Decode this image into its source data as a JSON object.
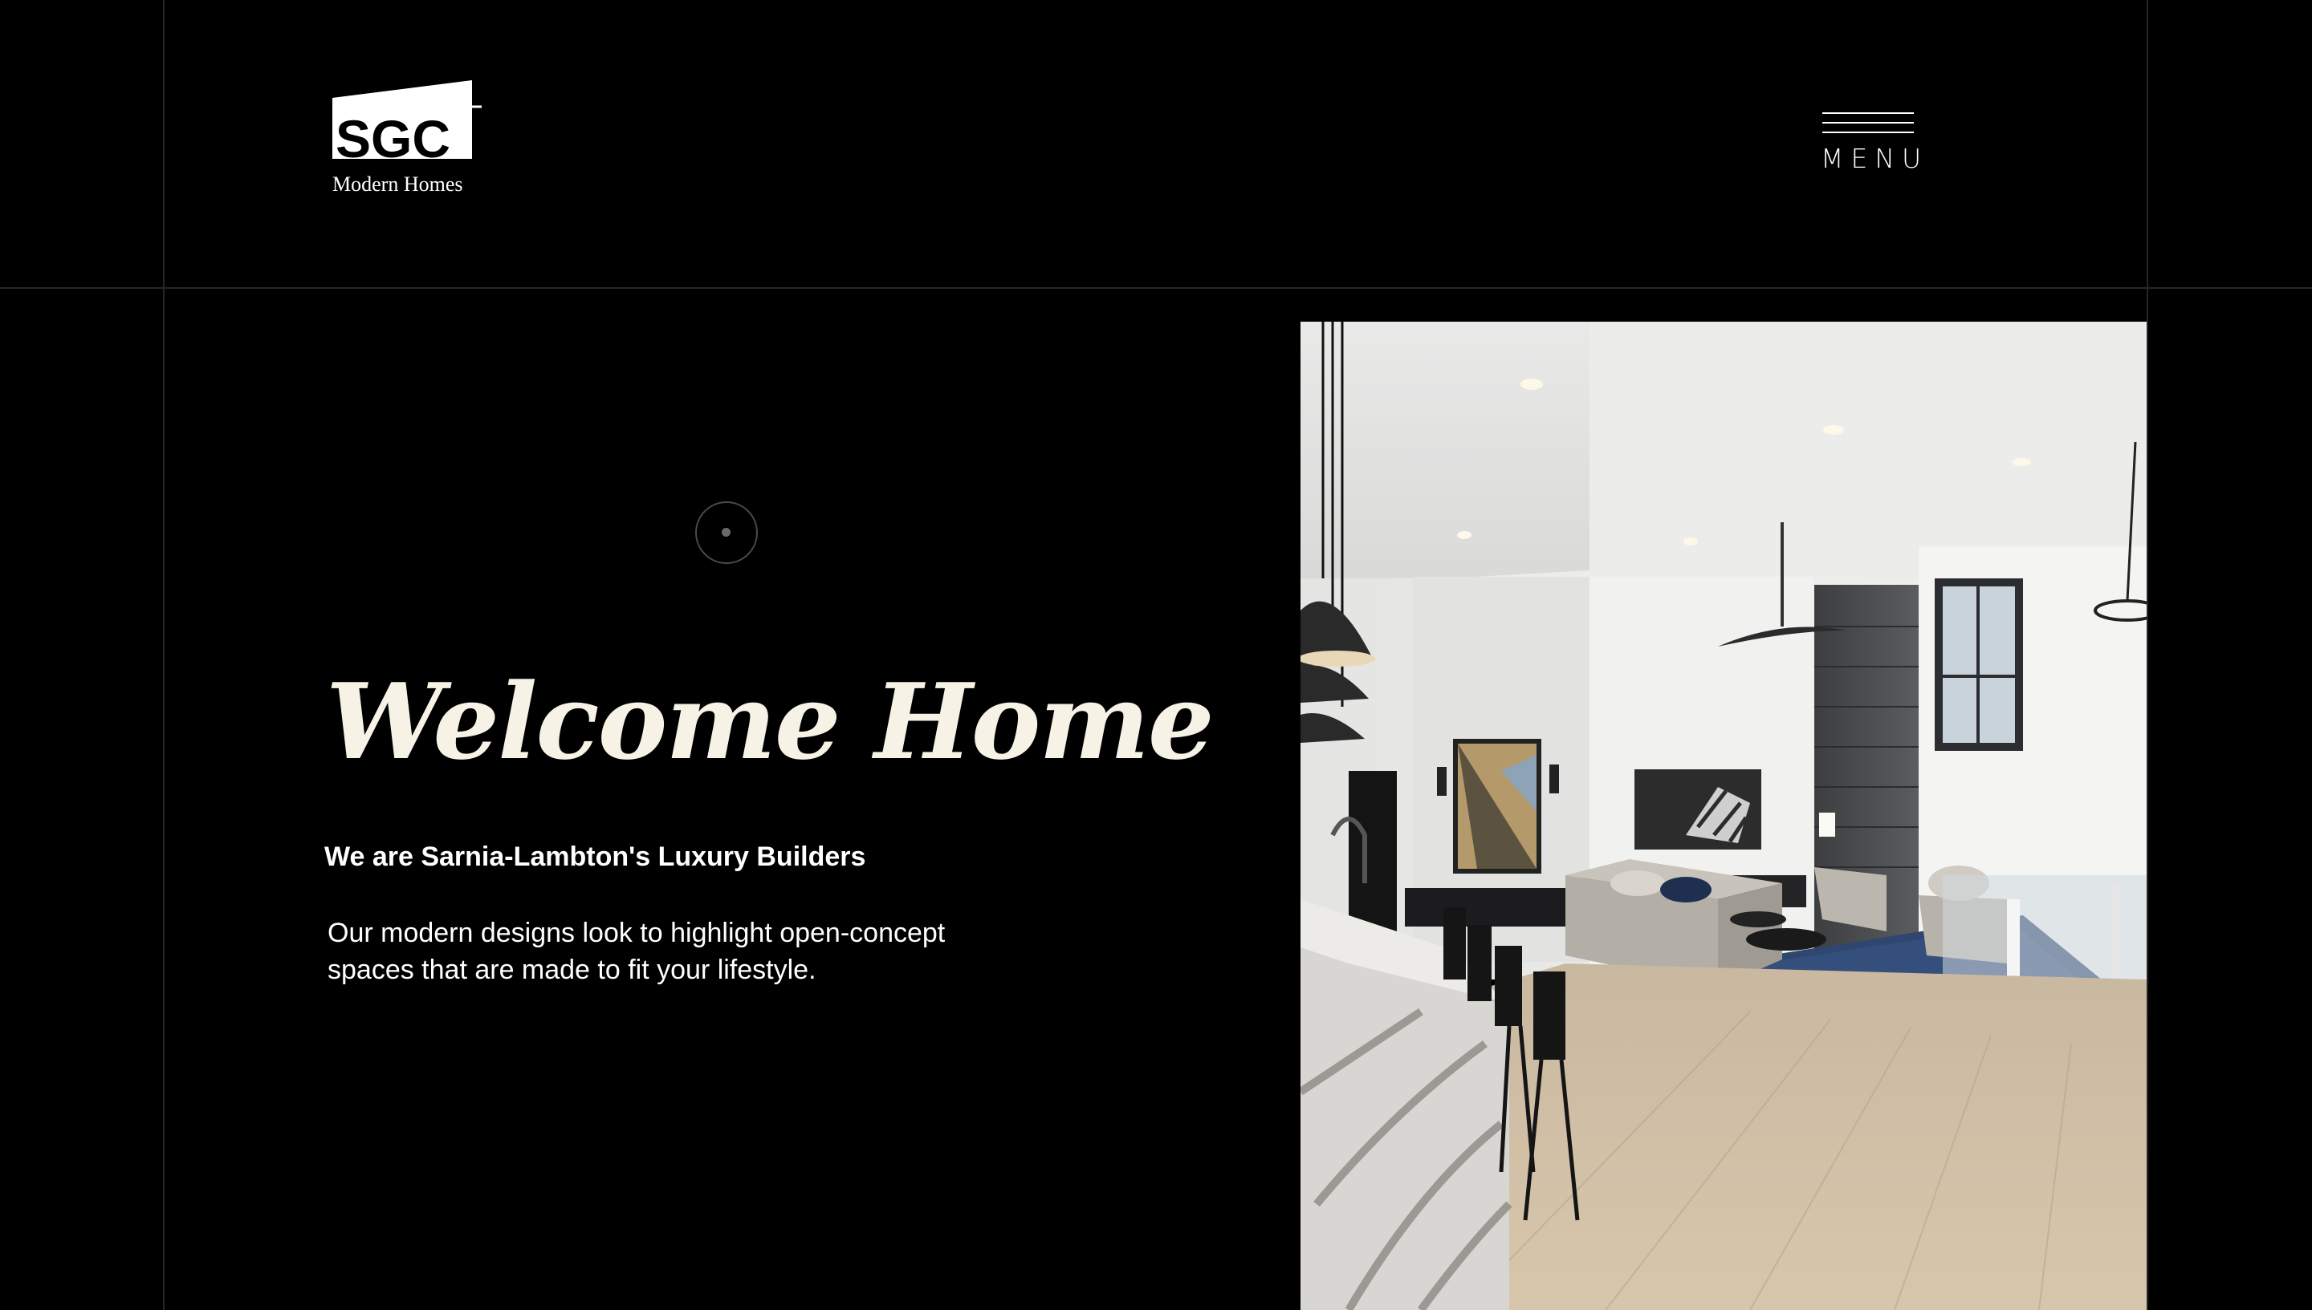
{
  "header": {
    "logo": {
      "mark": "SGC",
      "subtitle": "Modern Homes"
    },
    "menu_label": "MENU"
  },
  "hero": {
    "title": "Welcome Home",
    "subtitle": "We are Sarnia-Lambton's Luxury Builders",
    "body_line1": "Our modern designs look to highlight open-concept",
    "body_line2": "spaces that are made to fit your lifestyle."
  },
  "icons": {
    "menu": "hamburger-icon",
    "indicator": "scroll-indicator-icon"
  },
  "colors": {
    "background": "#000000",
    "title": "#f6f2e6",
    "text": "#ffffff",
    "grid_line": "#262626"
  }
}
